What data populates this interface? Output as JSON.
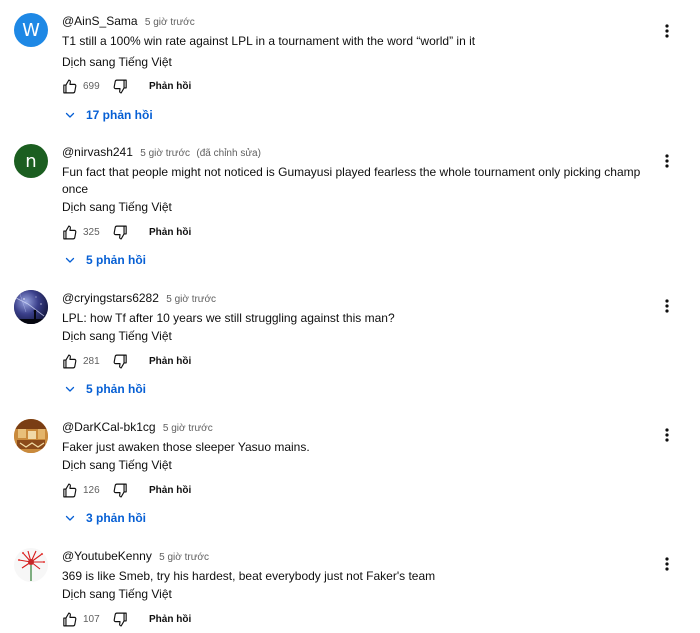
{
  "ui": {
    "translate_label": "Dịch sang Tiếng Việt",
    "reply_label": "Phản hồi"
  },
  "comments": [
    {
      "author": "@AinS_Sama",
      "time": "5 giờ trước",
      "edited": "",
      "text": "T1 still a 100% win rate against LPL in a tournament with the word “world” in it",
      "likes": "699",
      "replies": "17 phản hồi",
      "avatar_letter": "W",
      "avatar_color": "#1e88e5"
    },
    {
      "author": "@nirvash241",
      "time": "5 giờ trước",
      "edited": "(đã chỉnh sửa)",
      "text": "Fun fact that people might not noticed is Gumayusi played fearless the whole tournament only picking champ once",
      "likes": "325",
      "replies": "5 phản hồi",
      "avatar_letter": "n",
      "avatar_color": "#1b5e20"
    },
    {
      "author": "@cryingstars6282",
      "time": "5 giờ trước",
      "edited": "",
      "text": "LPL: how Tf after 10 years we still struggling against this man?",
      "likes": "281",
      "replies": "5 phản hồi",
      "avatar_letter": "",
      "avatar_color": "#1a1f4a"
    },
    {
      "author": "@DarKCal-bk1cg",
      "time": "5 giờ trước",
      "edited": "",
      "text": "Faker just awaken those sleeper Yasuo mains.",
      "likes": "126",
      "replies": "3 phản hồi",
      "avatar_letter": "",
      "avatar_color": "#b5651d"
    },
    {
      "author": "@YoutubeKenny",
      "time": "5 giờ trước",
      "edited": "",
      "text": "369 is like Smeb, try his hardest, beat everybody just not Faker's team",
      "likes": "107",
      "replies": "",
      "avatar_letter": "",
      "avatar_color": "#e53935"
    }
  ],
  "colors": {
    "link_blue": "#065fd4",
    "secondary_text": "#606060",
    "primary_text": "#0f0f0f"
  }
}
